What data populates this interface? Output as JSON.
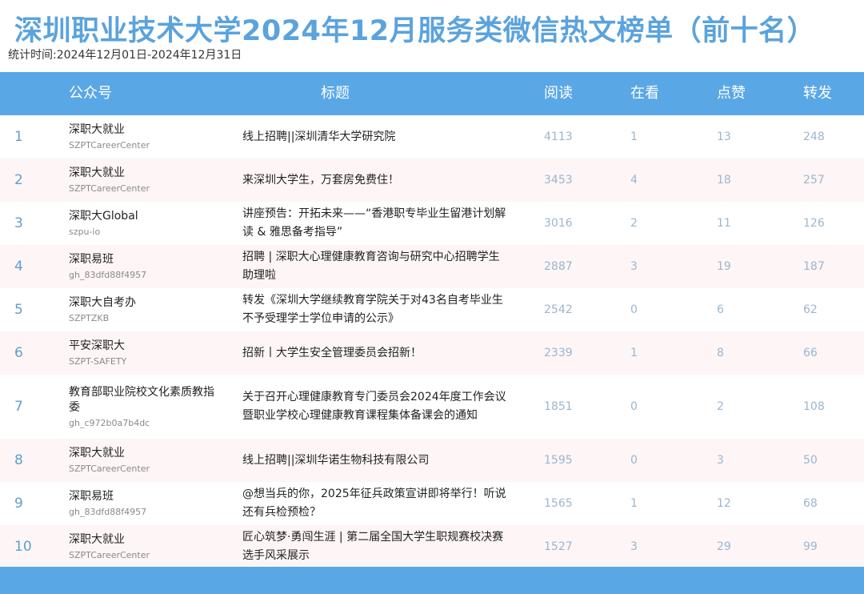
{
  "page": {
    "title": "深圳职业技术大学2024年12月服务类微信热文榜单（前十名）",
    "period": "统计时间:2024年12月01日-2024年12月31日"
  },
  "table": {
    "headers": {
      "account": "公众号",
      "title": "标题",
      "read": "阅读",
      "watch": "在看",
      "like": "点赞",
      "share": "转发"
    },
    "rows": [
      {
        "rank": "1",
        "account": "深职大就业",
        "account_id": "SZPTCareerCenter",
        "title": "线上招聘||深圳清华大学研究院",
        "read": "4113",
        "watch": "1",
        "like": "13",
        "share": "248"
      },
      {
        "rank": "2",
        "account": "深职大就业",
        "account_id": "SZPTCareerCenter",
        "title": "来深圳大学生，万套房免费住！",
        "read": "3453",
        "watch": "4",
        "like": "18",
        "share": "257"
      },
      {
        "rank": "3",
        "account": "深职大Global",
        "account_id": "szpu-io",
        "title": "讲座预告：开拓未来——“香港职专毕业生留港计划解读 & 雅思备考指导”",
        "read": "3016",
        "watch": "2",
        "like": "11",
        "share": "126"
      },
      {
        "rank": "4",
        "account": "深职易班",
        "account_id": "gh_83dfd88f4957",
        "title": "招聘 | 深职大心理健康教育咨询与研究中心招聘学生助理啦",
        "read": "2887",
        "watch": "3",
        "like": "19",
        "share": "187"
      },
      {
        "rank": "5",
        "account": "深职大自考办",
        "account_id": "SZPTZKB",
        "title": "转发《深圳大学继续教育学院关于对43名自考毕业生不予受理学士学位申请的公示》",
        "read": "2542",
        "watch": "0",
        "like": "6",
        "share": "62"
      },
      {
        "rank": "6",
        "account": "平安深职大",
        "account_id": "SZPT-SAFETY",
        "title": "招新丨大学生安全管理委员会招新！",
        "read": "2339",
        "watch": "1",
        "like": "8",
        "share": "66"
      },
      {
        "rank": "7",
        "account": "教育部职业院校文化素质教指委",
        "account_id": "gh_c972b0a7b4dc",
        "title": "关于召开心理健康教育专门委员会2024年度工作会议暨职业学校心理健康教育课程集体备课会的通知",
        "read": "1851",
        "watch": "0",
        "like": "2",
        "share": "108"
      },
      {
        "rank": "8",
        "account": "深职大就业",
        "account_id": "SZPTCareerCenter",
        "title": "线上招聘||深圳华诺生物科技有限公司",
        "read": "1595",
        "watch": "0",
        "like": "3",
        "share": "50"
      },
      {
        "rank": "9",
        "account": "深职易班",
        "account_id": "gh_83dfd88f4957",
        "title": "@想当兵的你，2025年征兵政策宣讲即将举行！听说还有兵检预检？",
        "read": "1565",
        "watch": "1",
        "like": "12",
        "share": "68"
      },
      {
        "rank": "10",
        "account": "深职大就业",
        "account_id": "SZPTCareerCenter",
        "title": "匠心筑梦·勇闯生涯 | 第二届全国大学生职规赛校决赛选手风采展示",
        "read": "1527",
        "watch": "3",
        "like": "29",
        "share": "99"
      }
    ]
  },
  "colors": {
    "title": "#5ba3dd",
    "header_bg": "#5aa7e6",
    "row_alt_bg": "#fdf5f6",
    "rank": "#5d9fd3",
    "number": "#9bb6cf"
  }
}
